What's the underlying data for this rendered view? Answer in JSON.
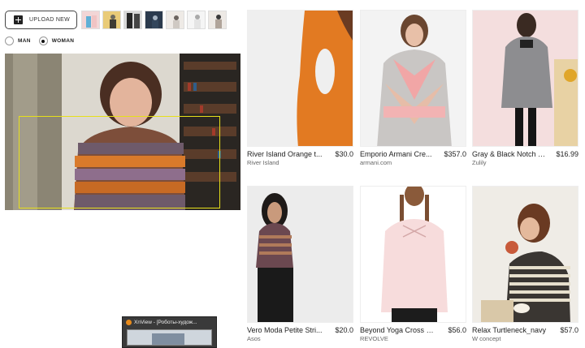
{
  "upload": {
    "label": "UPLOAD NEW"
  },
  "gender": {
    "options": [
      {
        "label": "MAN",
        "selected": false
      },
      {
        "label": "WOMAN",
        "selected": true
      }
    ]
  },
  "thumbnails": [
    {
      "name": "thumb-1",
      "colors": [
        "#f2d6d6",
        "#5fb0d6",
        "#f0e8dc"
      ]
    },
    {
      "name": "thumb-2",
      "colors": [
        "#e9cb78",
        "#6d6a5e",
        "#d9c29a"
      ]
    },
    {
      "name": "thumb-3",
      "colors": [
        "#262626",
        "#5c5c5c",
        "#d8d8d8"
      ]
    },
    {
      "name": "thumb-4",
      "colors": [
        "#33465c",
        "#a7b4c2",
        "#2b3a4d"
      ]
    },
    {
      "name": "thumb-5",
      "colors": [
        "#cfc9c3",
        "#6c6560",
        "#eeeae6"
      ]
    },
    {
      "name": "thumb-6",
      "colors": [
        "#f5f5f5",
        "#aaaaaa",
        "#e4e4e4"
      ]
    },
    {
      "name": "thumb-7",
      "colors": [
        "#3a3a3a",
        "#b0a49a",
        "#ede9e5"
      ]
    }
  ],
  "products": [
    {
      "name": "River Island Orange t...",
      "price": "$30.0",
      "store": "River Island"
    },
    {
      "name": "Emporio Armani Cre...",
      "price": "$357.0",
      "store": "armani.com"
    },
    {
      "name": "Gray & Black Notch N...",
      "price": "$16.99",
      "store": "Zulily"
    },
    {
      "name": "Vero Moda Petite Stri...",
      "price": "$20.0",
      "store": "Asos"
    },
    {
      "name": "Beyond Yoga Cross M...",
      "price": "$56.0",
      "store": "REVOLVE"
    },
    {
      "name": "Relax Turtleneck_navy",
      "price": "$57.0",
      "store": "W concept"
    }
  ],
  "taskbar": {
    "title": "XnView - [Роботы-худож..."
  },
  "colors": {
    "crop_box": "#e6df1a",
    "accent": "#222222"
  }
}
